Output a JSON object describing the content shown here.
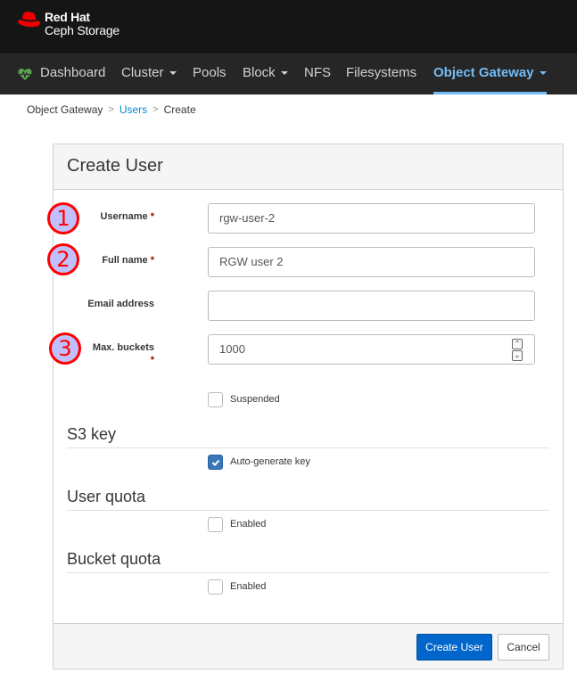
{
  "brand": {
    "line1": "Red Hat",
    "line2": "Ceph Storage",
    "logo_icon": "red-hat-fedora-icon",
    "color": "#ee0000"
  },
  "nav": {
    "items": [
      {
        "label": "Dashboard",
        "icon": "heartbeat-icon",
        "dropdown": false,
        "active": false
      },
      {
        "label": "Cluster",
        "dropdown": true,
        "active": false
      },
      {
        "label": "Pools",
        "dropdown": false,
        "active": false
      },
      {
        "label": "Block",
        "dropdown": true,
        "active": false
      },
      {
        "label": "NFS",
        "dropdown": false,
        "active": false
      },
      {
        "label": "Filesystems",
        "dropdown": false,
        "active": false
      },
      {
        "label": "Object Gateway",
        "dropdown": true,
        "active": true
      }
    ],
    "active_color": "#73bcf7"
  },
  "breadcrumb": {
    "items": [
      "Object Gateway",
      "Users",
      "Create"
    ],
    "separator": ">"
  },
  "form": {
    "title": "Create User",
    "fields": [
      {
        "label": "Username",
        "required": true,
        "value": "rgw-user-2",
        "annotation": "1"
      },
      {
        "label": "Full name",
        "required": true,
        "value": "RGW user 2",
        "annotation": "2"
      },
      {
        "label": "Email address",
        "required": false,
        "value": ""
      },
      {
        "label": "Max. buckets",
        "required": true,
        "value": "1000",
        "annotation": "3"
      }
    ],
    "required_marker": "*",
    "suspended": {
      "label": "Suspended",
      "checked": false
    },
    "sections": [
      {
        "title": "S3 key",
        "checkbox": {
          "label": "Auto-generate key",
          "checked": true
        }
      },
      {
        "title": "User quota",
        "checkbox": {
          "label": "Enabled",
          "checked": false
        }
      },
      {
        "title": "Bucket quota",
        "checkbox": {
          "label": "Enabled",
          "checked": false
        }
      }
    ],
    "spinner": {
      "up": "^",
      "down": "v"
    }
  },
  "footer": {
    "submit_label": "Create User",
    "cancel_label": "Cancel",
    "primary_color": "#0066cc"
  }
}
